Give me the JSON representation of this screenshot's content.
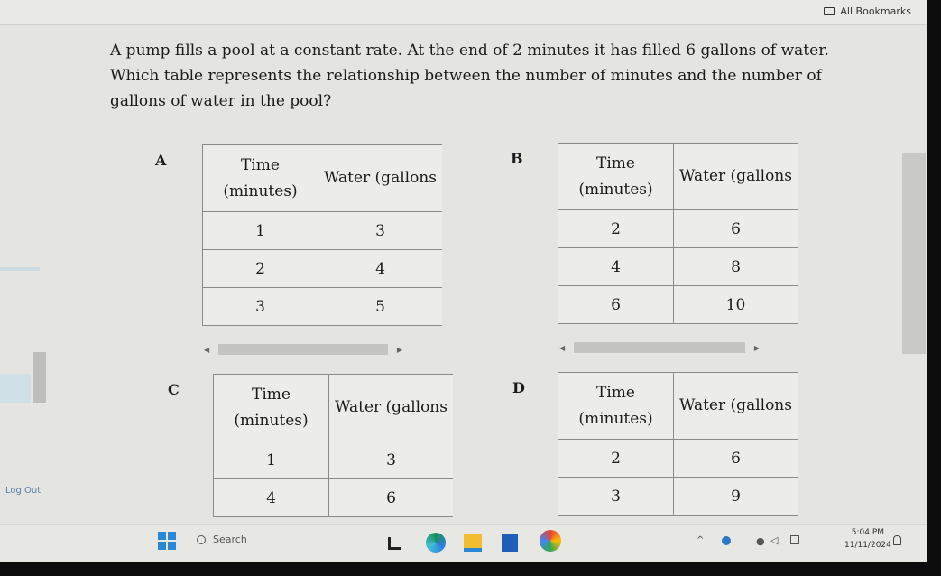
{
  "bookmarks_bar": {
    "label": "All Bookmarks"
  },
  "question": {
    "text": "A pump fills a pool at a constant rate. At the end of 2 minutes it has filled 6 gallons of water. Which table represents the relationship between the number of minutes and the number of gallons of water in the pool?"
  },
  "options": [
    {
      "letter": "A",
      "headers": [
        "Time (minutes)",
        "Water (gallons"
      ],
      "rows": [
        [
          "1",
          "3"
        ],
        [
          "2",
          "4"
        ],
        [
          "3",
          "5"
        ]
      ]
    },
    {
      "letter": "B",
      "headers": [
        "Time (minutes)",
        "Water (gallons"
      ],
      "rows": [
        [
          "2",
          "6"
        ],
        [
          "4",
          "8"
        ],
        [
          "6",
          "10"
        ]
      ]
    },
    {
      "letter": "C",
      "headers": [
        "Time (minutes)",
        "Water (gallons"
      ],
      "rows": [
        [
          "1",
          "3"
        ],
        [
          "4",
          "6"
        ]
      ]
    },
    {
      "letter": "D",
      "headers": [
        "Time (minutes)",
        "Water (gallons"
      ],
      "rows": [
        [
          "2",
          "6"
        ],
        [
          "3",
          "9"
        ]
      ]
    }
  ],
  "sidebar": {
    "logout_label": "Log Out"
  },
  "taskbar": {
    "search_placeholder": "Search",
    "time": "5:04 PM",
    "date": "11/11/2024"
  }
}
